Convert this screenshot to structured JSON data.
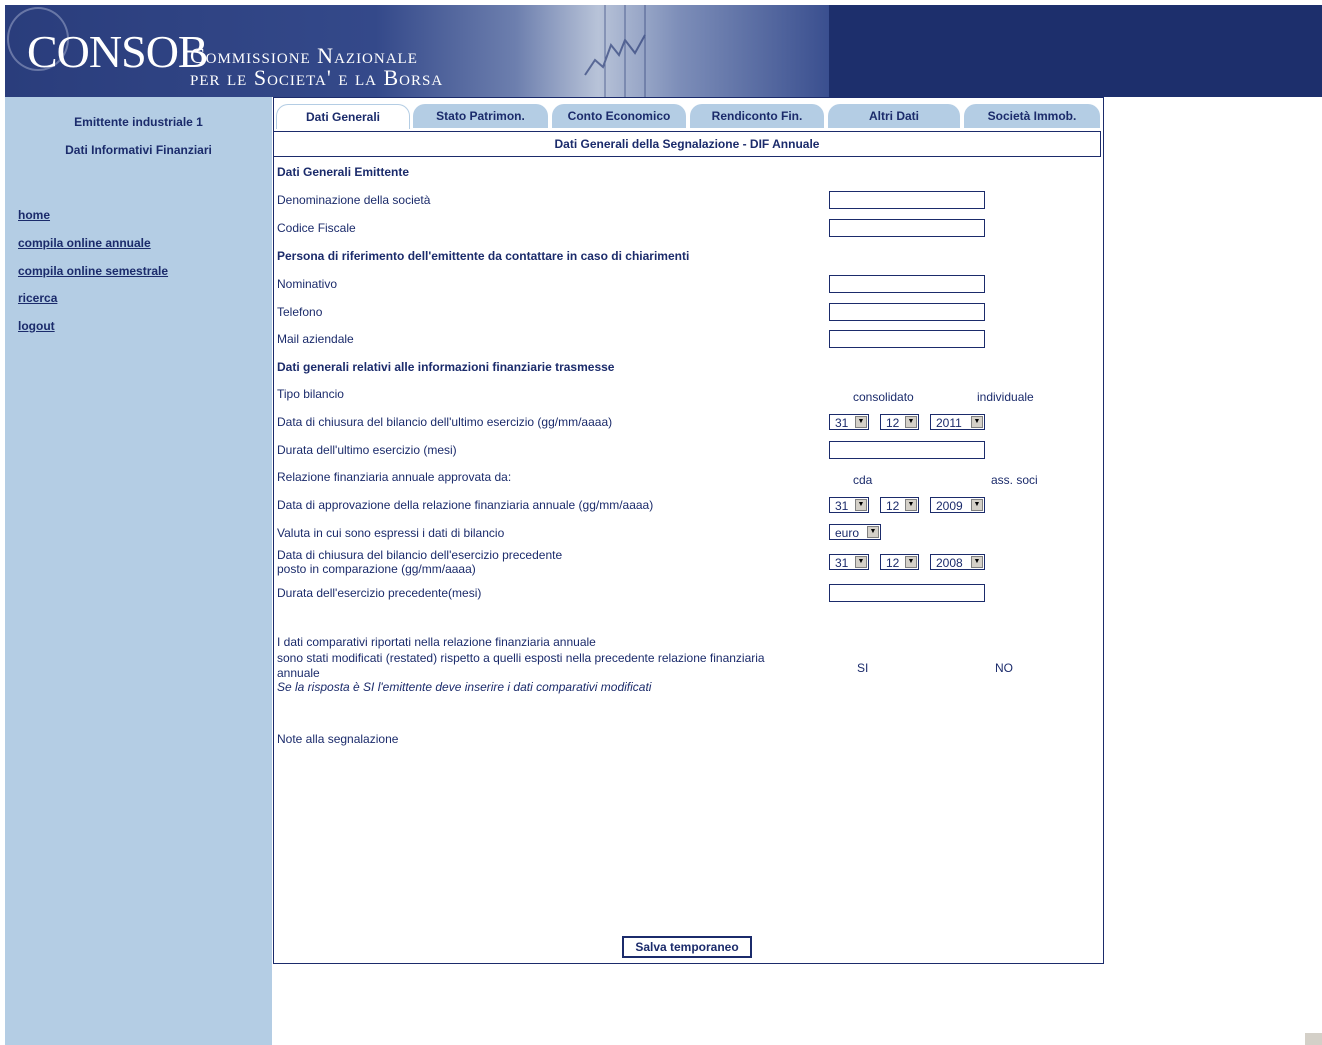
{
  "header": {
    "logo_main": "CONSOB",
    "logo_line1": "Commissione Nazionale",
    "logo_line2": "per le Societa' e la Borsa"
  },
  "sidebar": {
    "title1": "Emittente industriale 1",
    "title2": "Dati Informativi Finanziari",
    "links": [
      {
        "label": "home"
      },
      {
        "label": "compila online annuale"
      },
      {
        "label": "compila online semestrale"
      },
      {
        "label": "ricerca"
      },
      {
        "label": "logout"
      }
    ]
  },
  "tabs": [
    {
      "label": "Dati Generali",
      "active": true
    },
    {
      "label": "Stato Patrimon.",
      "active": false
    },
    {
      "label": "Conto Economico",
      "active": false
    },
    {
      "label": "Rendiconto Fin.",
      "active": false
    },
    {
      "label": "Altri Dati",
      "active": false
    },
    {
      "label": "Società Immob.",
      "active": false
    }
  ],
  "section_title": "Dati Generali della Segnalazione - DIF Annuale",
  "form": {
    "hdr_emittente": "Dati Generali Emittente",
    "denominazione": "Denominazione della società",
    "codice_fiscale": "Codice Fiscale",
    "hdr_persona": "Persona di riferimento dell'emittente da contattare in caso di chiarimenti",
    "nominativo": "Nominativo",
    "telefono": "Telefono",
    "mail": "Mail aziendale",
    "hdr_info": "Dati generali relativi alle informazioni finanziarie trasmesse",
    "tipo_bilancio": "Tipo bilancio",
    "tipo_opt1": "consolidato",
    "tipo_opt2": "individuale",
    "data_chiusura": "Data di chiusura del bilancio dell'ultimo esercizio (gg/mm/aaaa)",
    "data_chiusura_values": {
      "day": "31",
      "month": "12",
      "year": "2011"
    },
    "durata": "Durata dell'ultimo esercizio (mesi)",
    "relazione": "Relazione finanziaria annuale approvata da:",
    "rel_opt1": "cda",
    "rel_opt2": "ass. soci",
    "data_approvazione": "Data di approvazione della relazione finanziaria annuale (gg/mm/aaaa)",
    "data_approvazione_values": {
      "day": "31",
      "month": "12",
      "year": "2009"
    },
    "valuta": "Valuta in cui sono espressi i dati di bilancio",
    "valuta_value": "euro",
    "data_precedente_l1": "Data di chiusura del bilancio dell'esercizio precedente",
    "data_precedente_l2": "posto in comparazione (gg/mm/aaaa)",
    "data_precedente_values": {
      "day": "31",
      "month": "12",
      "year": "2008"
    },
    "durata_precedente": "Durata dell'esercizio precedente(mesi)",
    "comparativi_l1": "I dati comparativi riportati nella relazione finanziaria annuale",
    "comparativi_l2": "sono stati modificati (restated) rispetto a quelli esposti nella precedente relazione finanziaria",
    "comparativi_l3": "annuale",
    "comparativi_note": "Se la risposta è SI l'emittente deve inserire i dati comparativi modificati",
    "comp_opt1": "SI",
    "comp_opt2": "NO",
    "note": "Note alla segnalazione",
    "save_label": "Salva temporaneo"
  },
  "colors": {
    "navy": "#1b2b6b",
    "sidebar_bg": "#b4cde4",
    "header_bg": "#1d2f6c"
  }
}
